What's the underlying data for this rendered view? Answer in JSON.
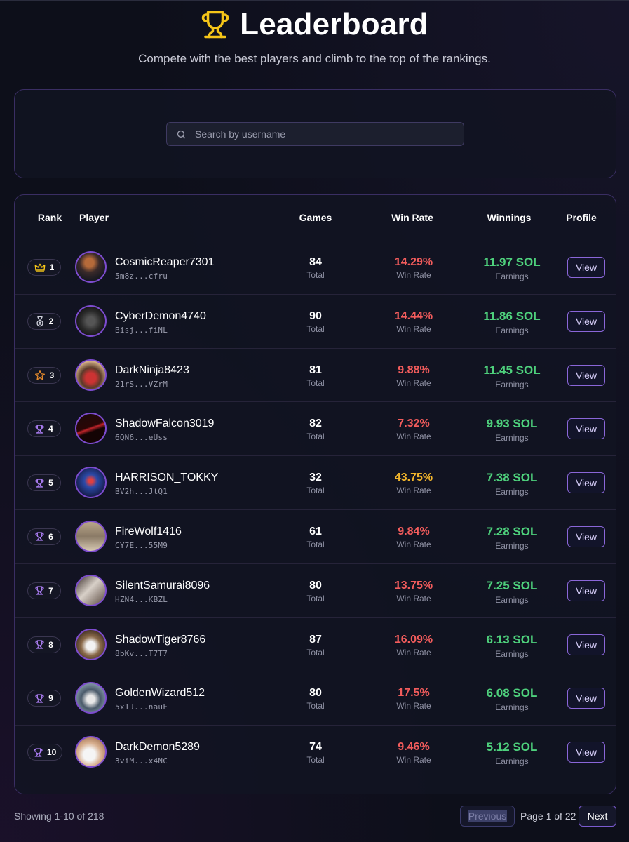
{
  "header": {
    "title": "Leaderboard",
    "title_icon": "trophy-icon",
    "subtitle": "Compete with the best players and climb to the top of the rankings."
  },
  "search": {
    "placeholder": "Search by username",
    "value": "",
    "icon": "search-icon"
  },
  "table": {
    "columns": {
      "rank": "Rank",
      "player": "Player",
      "games": "Games",
      "win_rate": "Win Rate",
      "winnings": "Winnings",
      "profile": "Profile"
    },
    "rows": [
      {
        "rank": "1",
        "rank_icon": "crown-icon",
        "name": "CosmicReaper7301",
        "address": "5m8z...cfru",
        "games": "84",
        "games_sub": "Total",
        "win_rate": "14.29%",
        "win_rate_sub": "Win Rate",
        "winnings": "11.97 SOL",
        "winnings_sub": "Earnings",
        "button": "View"
      },
      {
        "rank": "2",
        "rank_icon": "medal-icon",
        "name": "CyberDemon4740",
        "address": "Bisj...fiNL",
        "games": "90",
        "games_sub": "Total",
        "win_rate": "14.44%",
        "win_rate_sub": "Win Rate",
        "winnings": "11.86 SOL",
        "winnings_sub": "Earnings",
        "button": "View"
      },
      {
        "rank": "3",
        "rank_icon": "star-icon",
        "name": "DarkNinja8423",
        "address": "21rS...VZrM",
        "games": "81",
        "games_sub": "Total",
        "win_rate": "9.88%",
        "win_rate_sub": "Win Rate",
        "winnings": "11.45 SOL",
        "winnings_sub": "Earnings",
        "button": "View"
      },
      {
        "rank": "4",
        "rank_icon": "trophy-icon",
        "name": "ShadowFalcon3019",
        "address": "6QN6...eUss",
        "games": "82",
        "games_sub": "Total",
        "win_rate": "7.32%",
        "win_rate_sub": "Win Rate",
        "winnings": "9.93 SOL",
        "winnings_sub": "Earnings",
        "button": "View"
      },
      {
        "rank": "5",
        "rank_icon": "trophy-icon",
        "name": "HARRISON_TOKKY",
        "address": "BV2h...JtQ1",
        "games": "32",
        "games_sub": "Total",
        "win_rate": "43.75%",
        "win_rate_sub": "Win Rate",
        "winnings": "7.38 SOL",
        "winnings_sub": "Earnings",
        "button": "View"
      },
      {
        "rank": "6",
        "rank_icon": "trophy-icon",
        "name": "FireWolf1416",
        "address": "CY7E...55M9",
        "games": "61",
        "games_sub": "Total",
        "win_rate": "9.84%",
        "win_rate_sub": "Win Rate",
        "winnings": "7.28 SOL",
        "winnings_sub": "Earnings",
        "button": "View"
      },
      {
        "rank": "7",
        "rank_icon": "trophy-icon",
        "name": "SilentSamurai8096",
        "address": "HZN4...KBZL",
        "games": "80",
        "games_sub": "Total",
        "win_rate": "13.75%",
        "win_rate_sub": "Win Rate",
        "winnings": "7.25 SOL",
        "winnings_sub": "Earnings",
        "button": "View"
      },
      {
        "rank": "8",
        "rank_icon": "trophy-icon",
        "name": "ShadowTiger8766",
        "address": "8bKv...T7T7",
        "games": "87",
        "games_sub": "Total",
        "win_rate": "16.09%",
        "win_rate_sub": "Win Rate",
        "winnings": "6.13 SOL",
        "winnings_sub": "Earnings",
        "button": "View"
      },
      {
        "rank": "9",
        "rank_icon": "trophy-icon",
        "name": "GoldenWizard512",
        "address": "5x1J...nauF",
        "games": "80",
        "games_sub": "Total",
        "win_rate": "17.5%",
        "win_rate_sub": "Win Rate",
        "winnings": "6.08 SOL",
        "winnings_sub": "Earnings",
        "button": "View"
      },
      {
        "rank": "10",
        "rank_icon": "trophy-icon",
        "name": "DarkDemon5289",
        "address": "3viM...x4NC",
        "games": "74",
        "games_sub": "Total",
        "win_rate": "9.46%",
        "win_rate_sub": "Win Rate",
        "winnings": "5.12 SOL",
        "winnings_sub": "Earnings",
        "button": "View"
      }
    ]
  },
  "pagination": {
    "showing": "Showing 1-10 of 218",
    "previous": "Previous",
    "page_info": "Page 1 of 22",
    "next": "Next"
  },
  "colors": {
    "background": "#0d0f1a",
    "card_border": "#3a2e63",
    "accent_purple": "#8a66d8",
    "win_rate_red": "#f25c5c",
    "win_rate_gold": "#f2b52b",
    "winnings_green": "#4ed07c",
    "trophy_gold": "#f5c518"
  }
}
